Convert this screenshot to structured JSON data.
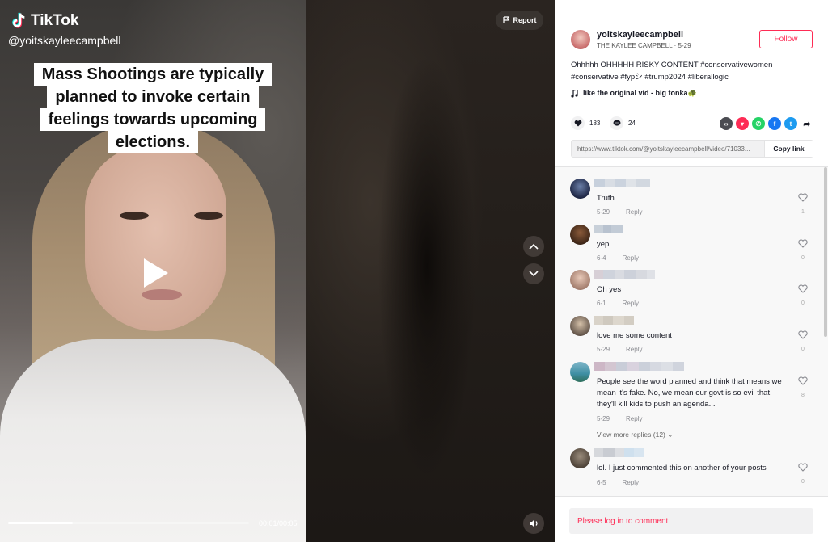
{
  "brand": {
    "name": "TikTok"
  },
  "video": {
    "handle": "@yoitskayleecampbell",
    "caption_lines": [
      "Mass Shootings are typically",
      "planned to invoke certain",
      "feelings towards upcoming",
      "elections."
    ],
    "time": "00:01/00:05",
    "progress_fraction": 0.27,
    "report_label": "Report"
  },
  "author": {
    "username": "yoitskayleecampbell",
    "display_name": "THE KAYLEE CAMPBELL",
    "date": "5-29",
    "follow_label": "Follow"
  },
  "post": {
    "description": "Ohhhhh OHHHHH RISKY CONTENT #conservativewomen #conservative #fypシ #trump2024 #liberallogic",
    "music": "like the original vid - big tonka🐢",
    "likes": "183",
    "comments": "24",
    "share_icons": [
      "embed-icon",
      "send-icon",
      "whatsapp-icon",
      "facebook-icon",
      "twitter-icon",
      "share-arrow-icon"
    ],
    "link": "https://www.tiktok.com/@yoitskayleecampbell/video/71033...",
    "copy_label": "Copy link"
  },
  "comments": [
    {
      "text": "Truth",
      "date": "5-29",
      "reply": "Reply",
      "likes": "1"
    },
    {
      "text": "yep",
      "date": "6-4",
      "reply": "Reply",
      "likes": "0"
    },
    {
      "text": "Oh yes",
      "date": "6-1",
      "reply": "Reply",
      "likes": "0"
    },
    {
      "text": "love me some content",
      "date": "5-29",
      "reply": "Reply",
      "likes": "0"
    },
    {
      "text": "People see the word planned and think that means we mean it's fake. No, we mean our govt is so evil that they'll kill kids to push an agenda...",
      "date": "5-29",
      "reply": "Reply",
      "likes": "8"
    },
    {
      "text": "lol. I just commented this on another of your posts",
      "date": "6-5",
      "reply": "Reply",
      "likes": "0"
    }
  ],
  "view_more": "View more replies (12)",
  "login_prompt": "Please log in to comment"
}
